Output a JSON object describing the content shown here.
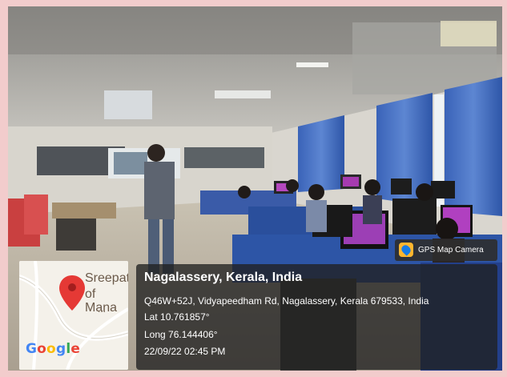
{
  "overlay": {
    "badge_label": "GPS Map Camera",
    "location_title": "Nagalassery, Kerala, India",
    "address": "Q46W+52J, Vidyapeedham Rd, Nagalassery, Kerala 679533, India",
    "latitude": "Lat 10.761857°",
    "longitude": "Long 76.144406°",
    "datetime": "22/09/22 02:45 PM"
  },
  "map": {
    "label_line1": "Sreepat",
    "label_line2": "of Mana",
    "ellipsis": "...",
    "google_letters": [
      "G",
      "o",
      "o",
      "g",
      "l",
      "e"
    ],
    "google_colors": [
      "#4285F4",
      "#EA4335",
      "#FBBC05",
      "#4285F4",
      "#34A853",
      "#EA4335"
    ],
    "pin_color": "#e53935"
  }
}
